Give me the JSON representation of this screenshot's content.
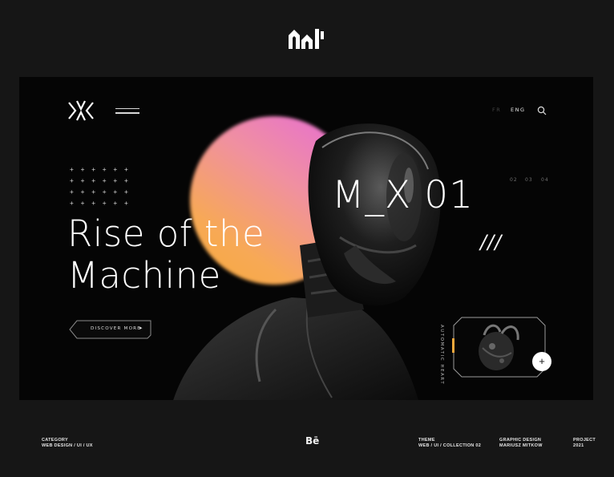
{
  "header": {
    "logo_icon": "studio-monogram-logo"
  },
  "hero": {
    "nav": {
      "lang_fr": "FR",
      "lang_eng": "ENG",
      "menu_icon": "hamburger-icon",
      "search_icon": "search-icon"
    },
    "model_name": "M_X 01",
    "pager": [
      "02",
      "03",
      "04"
    ],
    "headline_line1": "Rise of the",
    "headline_line2": "Machine",
    "slashes": "///",
    "cta_label": "DISCOVER MORE",
    "cta_arrow": "▸",
    "side_label": "AUTOMATIC HEART",
    "plus_label": "+",
    "accent_colors": {
      "orange": "#f7a93c",
      "pink": "#e56ad8"
    }
  },
  "footer": {
    "category_title": "CATEGORY",
    "category_value": "WEB DESIGN  /  UI  /  UX",
    "behance": "Bē",
    "theme_title": "THEME",
    "theme_value": "WEB / UI / COLLECTION 02",
    "graphic_title": "GRAPHIC DESIGN",
    "graphic_value": "MARIUSZ MITKOW",
    "project_title": "PROJECT",
    "project_value": "2021"
  }
}
